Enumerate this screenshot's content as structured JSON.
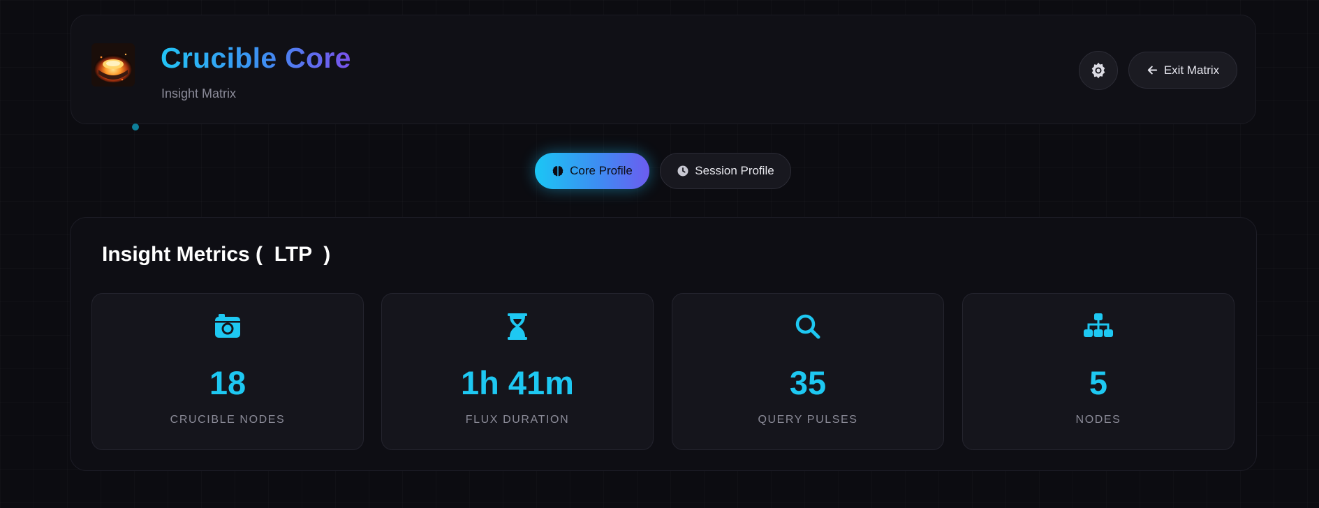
{
  "header": {
    "title": "Crucible Core",
    "subtitle": "Insight Matrix",
    "logo_icon": "crucible-fire-logo",
    "settings_icon": "gear-icon",
    "exit_label": "Exit Matrix",
    "exit_icon": "arrow-left-icon"
  },
  "tabs": [
    {
      "label": "Core Profile",
      "icon": "brain-icon",
      "active": true
    },
    {
      "label": "Session Profile",
      "icon": "clock-icon",
      "active": false
    }
  ],
  "metrics": {
    "title": "Insight Metrics (  LTP  )",
    "cards": [
      {
        "icon": "camera-retro-icon",
        "value": "18",
        "label": "CRUCIBLE NODES"
      },
      {
        "icon": "hourglass-icon",
        "value": "1h 41m",
        "label": "FLUX DURATION"
      },
      {
        "icon": "search-icon",
        "value": "35",
        "label": "QUERY PULSES"
      },
      {
        "icon": "sitemap-icon",
        "value": "5",
        "label": "NODES"
      }
    ]
  },
  "colors": {
    "accent": "#1ec8f2",
    "gradient_start": "#1bc6f4",
    "gradient_end": "#7a52ec",
    "background": "#0c0c11"
  }
}
